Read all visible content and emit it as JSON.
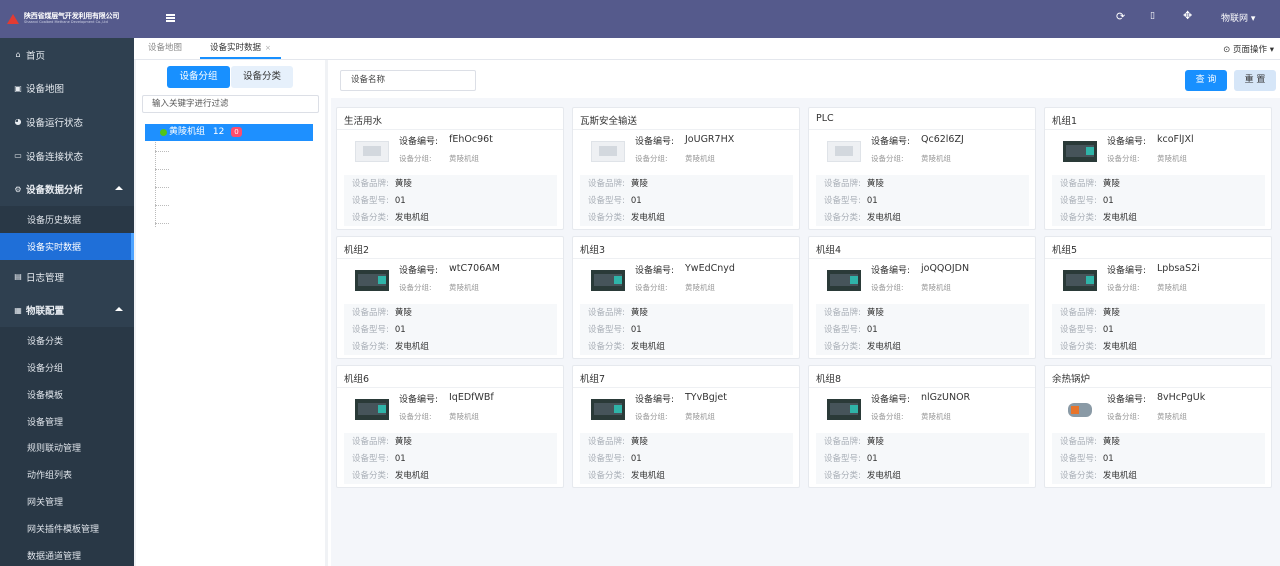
{
  "sidebar": {
    "logo_cn": "陕西省煤层气开发利用有限公司",
    "logo_en": "Shaanxi Coalbed Methane Development Co.,Ltd",
    "items": [
      {
        "label": "首页",
        "icon": "home-icon"
      },
      {
        "label": "设备地图",
        "icon": "map-icon"
      },
      {
        "label": "设备运行状态",
        "icon": "dashboard-icon"
      },
      {
        "label": "设备连接状态",
        "icon": "monitor-icon"
      },
      {
        "label": "设备数据分析",
        "icon": "cogs-icon"
      },
      {
        "label": "日志管理",
        "icon": "file-icon"
      },
      {
        "label": "物联配置",
        "icon": "calendar-icon"
      }
    ],
    "sub_analysis": [
      "设备历史数据",
      "设备实时数据"
    ],
    "sub_config": [
      "设备分类",
      "设备分组",
      "设备模板",
      "设备管理",
      "规则联动管理",
      "动作组列表",
      "网关管理",
      "网关插件模板管理",
      "数据通道管理"
    ]
  },
  "topbar": {
    "user": "物联网",
    "icons": [
      "refresh-icon",
      "trash-icon",
      "fullscreen-icon"
    ]
  },
  "tabs": {
    "items": [
      "设备地图",
      "设备实时数据"
    ],
    "close_glyph": "×",
    "page_ops": "页面操作"
  },
  "left_panel": {
    "toggle_group": "设备分组",
    "toggle_category": "设备分类",
    "filter_placeholder": "输入关键字进行过滤",
    "tree_root": {
      "label": "黄陵机组",
      "count": "12",
      "badge": "0"
    }
  },
  "main": {
    "search_placeholder": "设备名称",
    "query_label": "查 询",
    "reset_label": "重 置",
    "labels": {
      "code": "设备编号:",
      "group": "设备分组:",
      "brand": "设备品牌:",
      "model": "设备型号:",
      "category": "设备分类:"
    },
    "cards": [
      {
        "name": "生活用水",
        "code": "fEhOc96t",
        "group": "黄陵机组",
        "brand": "黄陵",
        "model": "01",
        "category": "发电机组",
        "image": "placeholder"
      },
      {
        "name": "瓦斯安全输送",
        "code": "JoUGR7HX",
        "group": "黄陵机组",
        "brand": "黄陵",
        "model": "01",
        "category": "发电机组",
        "image": "placeholder"
      },
      {
        "name": "PLC",
        "code": "Qc62l6ZJ",
        "group": "黄陵机组",
        "brand": "黄陵",
        "model": "01",
        "category": "发电机组",
        "image": "placeholder"
      },
      {
        "name": "机组1",
        "code": "kcoFlJXl",
        "group": "黄陵机组",
        "brand": "黄陵",
        "model": "01",
        "category": "发电机组",
        "image": "generator"
      },
      {
        "name": "机组2",
        "code": "wtC706AM",
        "group": "黄陵机组",
        "brand": "黄陵",
        "model": "01",
        "category": "发电机组",
        "image": "generator"
      },
      {
        "name": "机组3",
        "code": "YwEdCnyd",
        "group": "黄陵机组",
        "brand": "黄陵",
        "model": "01",
        "category": "发电机组",
        "image": "generator"
      },
      {
        "name": "机组4",
        "code": "joQQOJDN",
        "group": "黄陵机组",
        "brand": "黄陵",
        "model": "01",
        "category": "发电机组",
        "image": "generator"
      },
      {
        "name": "机组5",
        "code": "LpbsaS2i",
        "group": "黄陵机组",
        "brand": "黄陵",
        "model": "01",
        "category": "发电机组",
        "image": "generator"
      },
      {
        "name": "机组6",
        "code": "IqEDfWBf",
        "group": "黄陵机组",
        "brand": "黄陵",
        "model": "01",
        "category": "发电机组",
        "image": "generator"
      },
      {
        "name": "机组7",
        "code": "TYvBgjet",
        "group": "黄陵机组",
        "brand": "黄陵",
        "model": "01",
        "category": "发电机组",
        "image": "generator"
      },
      {
        "name": "机组8",
        "code": "nlGzUNOR",
        "group": "黄陵机组",
        "brand": "黄陵",
        "model": "01",
        "category": "发电机组",
        "image": "generator"
      },
      {
        "name": "余热锅炉",
        "code": "8vHcPgUk",
        "group": "黄陵机组",
        "brand": "黄陵",
        "model": "01",
        "category": "发电机组",
        "image": "boiler"
      }
    ]
  },
  "colors": {
    "topbar": "#555a8c",
    "sidebar": "#2f4050",
    "active": "#1f6fd8",
    "primary": "#1890ff"
  }
}
